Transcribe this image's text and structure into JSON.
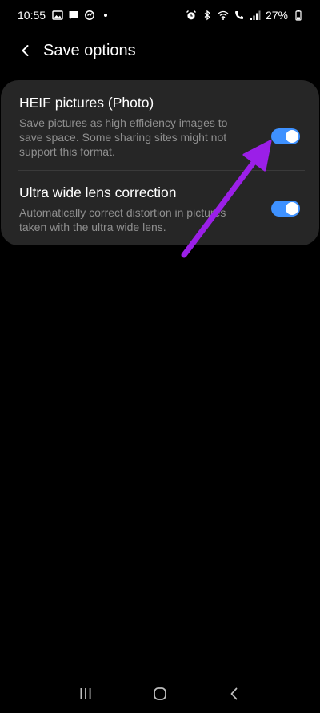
{
  "status_bar": {
    "time": "10:55",
    "battery": "27%",
    "left_icons": [
      "gallery-icon",
      "message-icon",
      "sync-icon",
      "dot-icon"
    ],
    "right_icons": [
      "alarm-icon",
      "bluetooth-icon",
      "wifi-icon",
      "call-signal-icon",
      "signal-icon",
      "battery-icon"
    ]
  },
  "header": {
    "title": "Save options",
    "back_icon": "chevron-left-icon"
  },
  "settings": [
    {
      "title": "HEIF pictures (Photo)",
      "description": "Save pictures as high efficiency images to save space. Some sharing sites might not support this format.",
      "enabled": true
    },
    {
      "title": "Ultra wide lens correction",
      "description": "Automatically correct distortion in pictures taken with the ultra wide lens.",
      "enabled": true
    }
  ],
  "colors": {
    "background": "#000000",
    "card": "#262626",
    "toggle_on": "#3e91ff",
    "description_text": "#8f8f8f",
    "annotation_arrow": "#9b1fe8"
  },
  "nav_bar": {
    "icons": [
      "recents-icon",
      "home-icon",
      "back-icon"
    ]
  }
}
